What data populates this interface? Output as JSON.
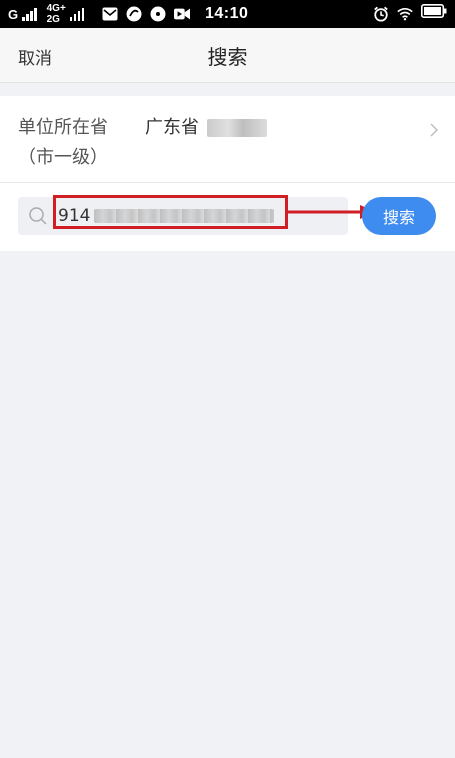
{
  "status_bar": {
    "carrier_1": "G",
    "network_type_1": "4G+",
    "network_type_2": "2G",
    "time": "14:10"
  },
  "nav": {
    "cancel_label": "取消",
    "title": "搜索"
  },
  "location": {
    "label": "单位所在省（市一级）",
    "province": "广东省"
  },
  "search": {
    "value_prefix": "914",
    "button_label": "搜索"
  },
  "colors": {
    "accent": "#3f8cf0",
    "highlight": "#d01e25"
  },
  "icons": {
    "search": "search-icon",
    "chevron": "chevron-right-icon"
  }
}
